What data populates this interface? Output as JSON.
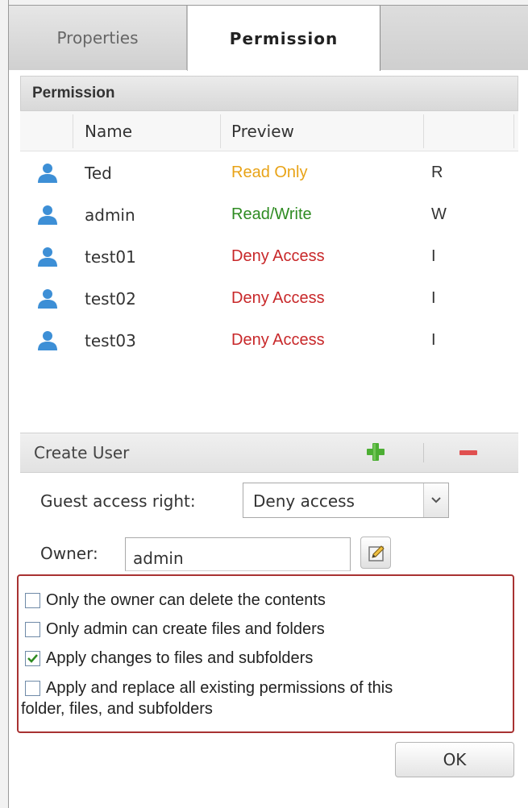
{
  "tabs": [
    {
      "label": "Properties",
      "active": false
    },
    {
      "label": "Permission",
      "active": true
    }
  ],
  "section_title": "Permission",
  "columns": {
    "name": "Name",
    "preview": "Preview",
    "perm": ""
  },
  "users": [
    {
      "name": "Ted",
      "preview": "Read Only",
      "preview_color": "#e8a317",
      "perm": "R"
    },
    {
      "name": "admin",
      "preview": "Read/Write",
      "preview_color": "#2e8b22",
      "perm": "W"
    },
    {
      "name": "test01",
      "preview": "Deny Access",
      "preview_color": "#c8282a",
      "perm": "I"
    },
    {
      "name": "test02",
      "preview": "Deny Access",
      "preview_color": "#c8282a",
      "perm": "I"
    },
    {
      "name": "test03",
      "preview": "Deny Access",
      "preview_color": "#c8282a",
      "perm": "I"
    }
  ],
  "create_user": {
    "label": "Create User",
    "add_icon": "plus-icon",
    "remove_icon": "minus-icon"
  },
  "guest_access": {
    "label": "Guest access right:",
    "value": "Deny access"
  },
  "owner": {
    "label": "Owner:",
    "value": "admin",
    "edit_icon": "edit-icon"
  },
  "options": [
    {
      "label": "Only the owner can delete the contents",
      "checked": false
    },
    {
      "label": "Only admin can create files and folders",
      "checked": false
    },
    {
      "label": "Apply changes to files and subfolders",
      "checked": true
    },
    {
      "label": "Apply and replace all existing permissions of this",
      "label_line2": "folder, files, and subfolders",
      "checked": false
    }
  ],
  "ok_label": "OK",
  "colors": {
    "accent_green": "#4cae33",
    "accent_red": "#e05050",
    "user_icon": "#3d8fd6",
    "option_border": "#a83232"
  }
}
